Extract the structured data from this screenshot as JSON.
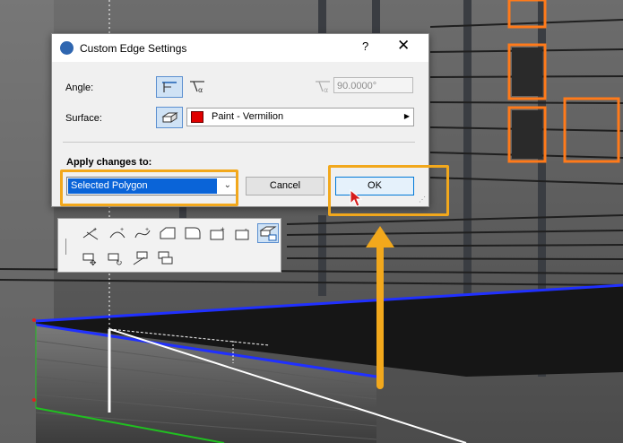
{
  "dialog": {
    "title": "Custom Edge Settings",
    "help": "?",
    "close": "✕",
    "angle_label": "Angle:",
    "angle_value": "90.0000°",
    "surface_label": "Surface:",
    "surface_value": "Paint - Vermilion",
    "surface_color": "#e00000",
    "apply_label": "Apply changes to:",
    "apply_selected": "Selected Polygon",
    "cancel_label": "Cancel",
    "ok_label": "OK"
  },
  "toolbar": {
    "tools": [
      "add-edge-icon",
      "add-curve-icon",
      "add-bezier-icon",
      "chamfer-icon",
      "fillet-icon",
      "add-corner-icon",
      "subtract-corner-icon",
      "custom-edge-icon",
      "move-node-icon",
      "rotate-node-icon",
      "offset-edge-icon",
      "offset-all-icon"
    ],
    "selected_tool": "custom-edge-icon"
  },
  "annotation": {
    "highlight_color": "#f2a81c"
  }
}
